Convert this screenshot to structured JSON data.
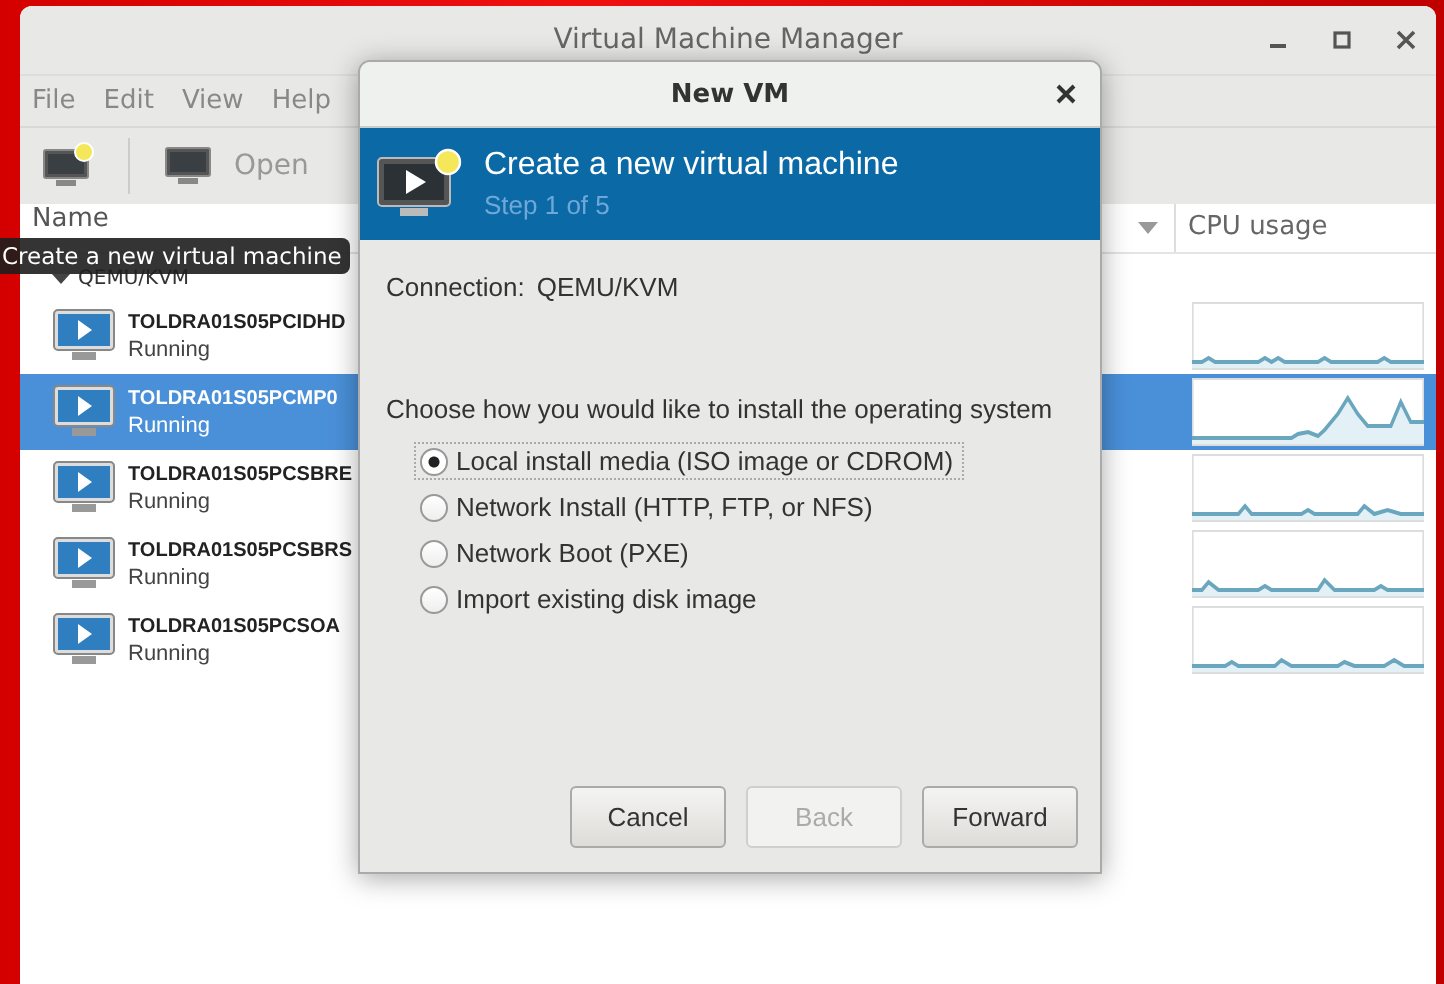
{
  "window": {
    "title": "Virtual Machine Manager"
  },
  "menu": [
    "File",
    "Edit",
    "View",
    "Help"
  ],
  "toolbar": {
    "open_label": "Open"
  },
  "tooltip": "Create a new virtual machine",
  "table": {
    "columns": [
      "Name",
      "CPU usage"
    ],
    "group": {
      "label": "QEMU/KVM",
      "expanded": true
    },
    "rows": [
      {
        "name": "TOLDRA01S05PCIDHD",
        "status": "Running",
        "selected": false
      },
      {
        "name": "TOLDRA01S05PCMP0",
        "status": "Running",
        "selected": true
      },
      {
        "name": "TOLDRA01S05PCSBRE",
        "status": "Running",
        "selected": false
      },
      {
        "name": "TOLDRA01S05PCSBRS",
        "status": "Running",
        "selected": false
      },
      {
        "name": "TOLDRA01S05PCSOA",
        "status": "Running",
        "selected": false
      }
    ]
  },
  "dialog": {
    "title": "New VM",
    "heading": "Create a new virtual machine",
    "step": "Step 1 of 5",
    "connection_label": "Connection:",
    "connection": "QEMU/KVM",
    "prompt": "Choose how you would like to install the operating system",
    "options": [
      {
        "label": "Local install media (ISO image or CDROM)",
        "selected": true
      },
      {
        "label": "Network Install (HTTP, FTP, or NFS)",
        "selected": false
      },
      {
        "label": "Network Boot (PXE)",
        "selected": false
      },
      {
        "label": "Import existing disk image",
        "selected": false
      }
    ],
    "buttons": [
      {
        "label": "Cancel",
        "disabled": false
      },
      {
        "label": "Back",
        "disabled": true
      },
      {
        "label": "Forward",
        "disabled": false
      }
    ]
  }
}
